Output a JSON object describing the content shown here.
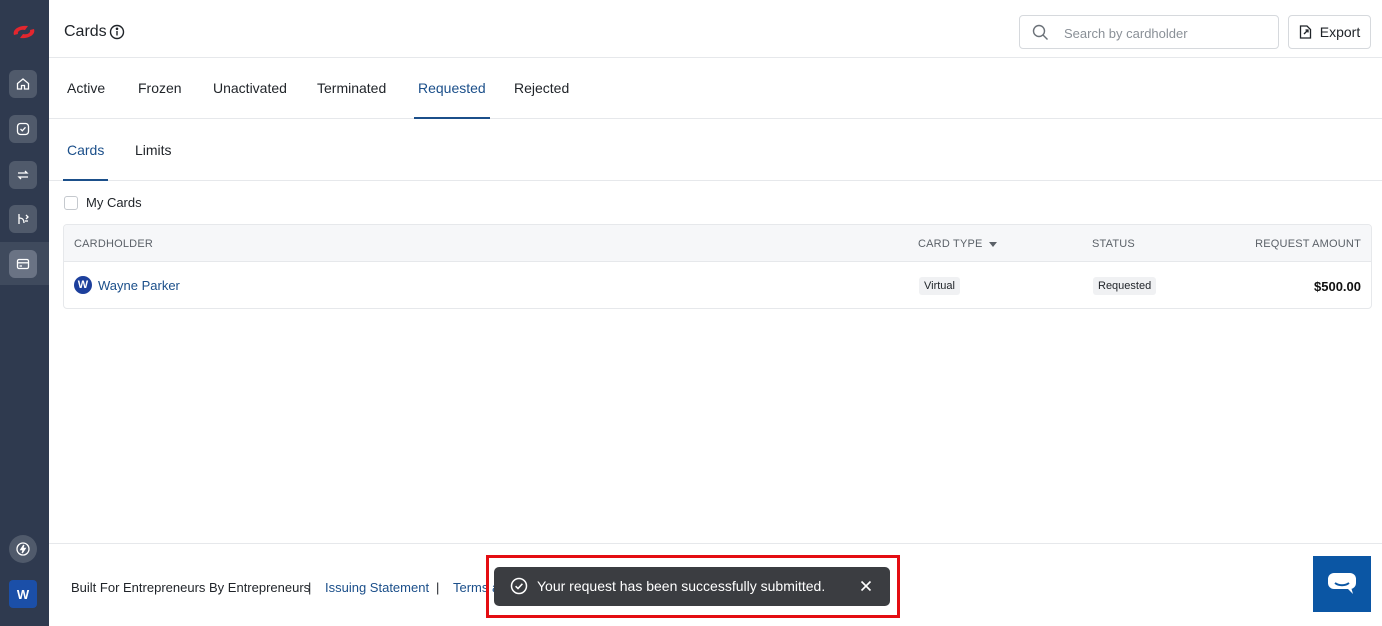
{
  "sidebar": {
    "logo": "brand-logo",
    "items": [
      {
        "icon": "home-icon"
      },
      {
        "icon": "check-circle-icon"
      },
      {
        "icon": "transfer-icon"
      },
      {
        "icon": "routing-icon"
      },
      {
        "icon": "card-icon",
        "active": true
      }
    ],
    "bottom_icon": "bolt-icon",
    "user_initial": "W"
  },
  "header": {
    "title": "Cards",
    "search_placeholder": "Search by cardholder",
    "export_label": "Export"
  },
  "tabs": [
    "Active",
    "Frozen",
    "Unactivated",
    "Terminated",
    "Requested",
    "Rejected"
  ],
  "active_tab": "Requested",
  "subtabs": [
    "Cards",
    "Limits"
  ],
  "active_subtab": "Cards",
  "filter": {
    "my_cards_label": "My Cards",
    "checked": false
  },
  "table": {
    "columns": [
      "CARDHOLDER",
      "CARD TYPE",
      "STATUS",
      "REQUEST AMOUNT"
    ],
    "rows": [
      {
        "initial": "W",
        "cardholder": "Wayne Parker",
        "card_type": "Virtual",
        "status": "Requested",
        "amount": "$500.00"
      }
    ]
  },
  "footer": {
    "tagline": "Built For Entrepreneurs By Entrepreneurs",
    "separator": "|",
    "link1": "Issuing Statement",
    "link2": "Terms a"
  },
  "toast": {
    "message": "Your request has been successfully submitted."
  },
  "colors": {
    "sidebar": "#2f3a4f",
    "accent": "#1b4f8a",
    "toast": "#3b3d41",
    "highlight": "#e40d12",
    "chat": "#0b56a4"
  }
}
